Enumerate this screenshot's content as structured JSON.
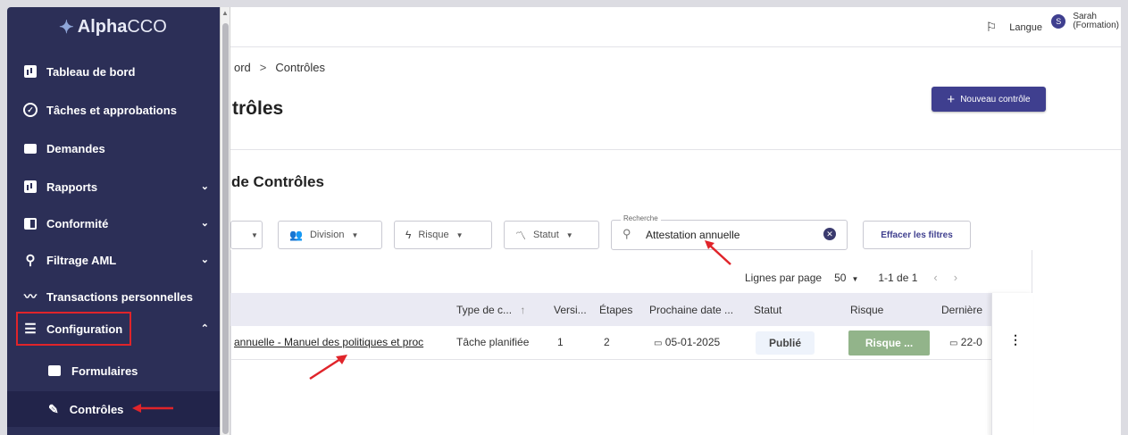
{
  "app": {
    "logo_prefix": "Alpha",
    "logo_suffix": "CCO"
  },
  "sidebar": {
    "items": [
      {
        "label": "Tableau de bord"
      },
      {
        "label": "Tâches et approbations"
      },
      {
        "label": "Demandes"
      },
      {
        "label": "Rapports"
      },
      {
        "label": "Conformité"
      },
      {
        "label": "Filtrage AML"
      },
      {
        "label": "Transactions personnelles"
      },
      {
        "label": "Configuration"
      }
    ],
    "sub_items": [
      {
        "label": "Formulaires"
      },
      {
        "label": "Contrôles"
      }
    ]
  },
  "header": {
    "language_label": "Langue",
    "user_initial": "S",
    "user_name": "Sarah",
    "user_role": "(Formation)"
  },
  "breadcrumb": {
    "parent": "ord",
    "separator": ">",
    "current": "Contrôles"
  },
  "page": {
    "title": "trôles",
    "new_button_label": "Nouveau contrôle",
    "section_title": "de Contrôles"
  },
  "filters": {
    "division_label": "Division",
    "risque_label": "Risque",
    "statut_label": "Statut",
    "search_label": "Recherche",
    "search_value": "Attestation annuelle",
    "clear_label": "Effacer les filtres"
  },
  "pagination": {
    "rows_per_page_label": "Lignes par page",
    "rows_per_page_value": "50",
    "range": "1-1 de 1"
  },
  "table": {
    "columns": [
      "Type de c...",
      "Versi...",
      "Étapes",
      "Prochaine date ...",
      "Statut",
      "Risque",
      "Dernière"
    ],
    "rows": [
      {
        "name": "annuelle - Manuel des politiques et proc",
        "type": "Tâche planifiée",
        "version": "1",
        "etapes": "2",
        "prochaine_date": "05-01-2025",
        "statut": "Publié",
        "risque": "Risque ...",
        "derniere": "22-0"
      }
    ]
  },
  "colors": {
    "sidebar_bg": "#2c2f57",
    "primary": "#3f3f8f",
    "risk_badge": "#92b48a",
    "highlight_red": "#e0242a"
  }
}
